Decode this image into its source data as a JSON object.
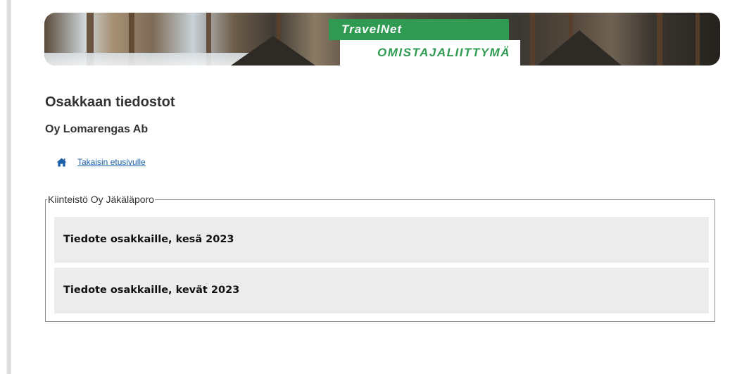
{
  "banner": {
    "brand_top": "TravelNet",
    "brand_bottom": "OMISTAJALIITTYMÄ"
  },
  "page": {
    "title": "Osakkaan tiedostot",
    "company": "Oy Lomarengas Ab"
  },
  "back_link": {
    "icon": "home-icon",
    "label": "Takaisin etusivulle"
  },
  "property": {
    "name": "Kiinteistö Oy Jäkäläporo",
    "documents": [
      {
        "title": "Tiedote osakkaille, kesä 2023"
      },
      {
        "title": "Tiedote osakkaille, kevät 2023"
      }
    ]
  },
  "colors": {
    "brand_green": "#2f9a52",
    "link_blue": "#1a5fa8",
    "item_bg": "#ececec"
  }
}
